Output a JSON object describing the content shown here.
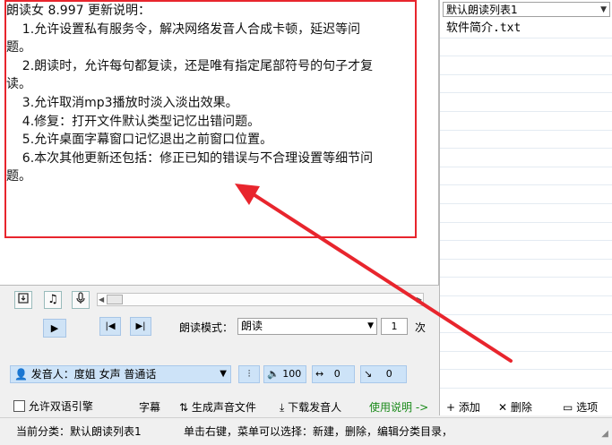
{
  "text_lines": [
    "朗读女 8.997 更新说明：",
    "    1.允许设置私有服务令，解决网络发音人合成卡顿，延迟等问",
    "题。",
    "    2.朗读时，允许每句都复读，还是唯有指定尾部符号的句子才复",
    "读。",
    "    3.允许取消mp3播放时淡入淡出效果。",
    "    4.修复：打开文件默认类型记忆出错问题。",
    "    5.允许桌面字幕窗口记忆退出之前窗口位置。",
    "    6.本次其他更新还包括：修正已知的错误与不合理设置等细节问",
    "题。"
  ],
  "list_select": "默认朗读列表1",
  "files": [
    "软件简介.txt"
  ],
  "mode_label": "朗读模式：",
  "mode_value": "朗读",
  "count_value": "1",
  "count_unit": "次",
  "voice_label": "发音人：度姐 女声 普通话",
  "volume": "100",
  "speed": "0",
  "pitch": "0",
  "checkbox_label": "允许双语引擎",
  "subtitle_label": "字幕",
  "generate_label": "生成声音文件",
  "download_label": "下载发音人",
  "help_label": "使用说明 ->",
  "add_label": "添加",
  "delete_label": "删除",
  "options_label": "选项",
  "status_left": "当前分类：默认朗读列表1",
  "status_right": "单击右键，菜单可以选择：新建，删除，编辑分类目录，",
  "colors": {
    "annotation": "#e8252d",
    "accent": "#cde3f8",
    "link": "#1a8a1a"
  }
}
